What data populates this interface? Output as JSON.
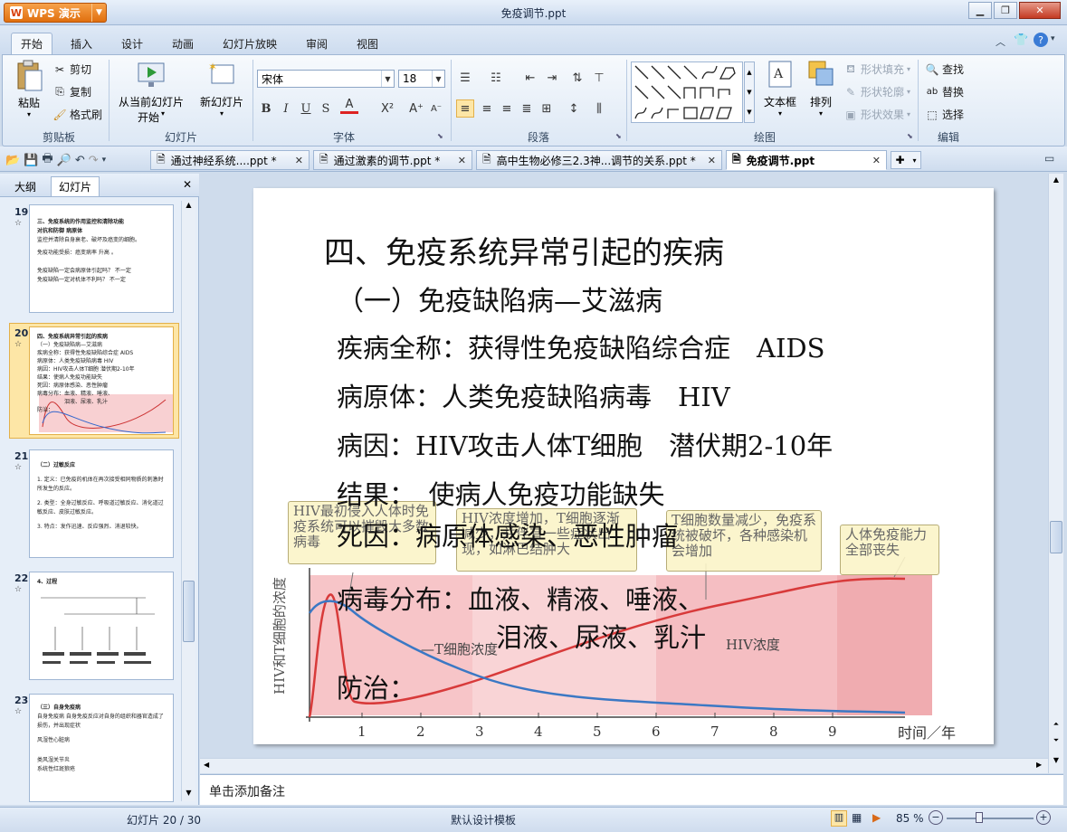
{
  "app": {
    "name": "WPS 演示",
    "window_title": "免疫调节.ppt"
  },
  "menu": {
    "tabs": [
      "开始",
      "插入",
      "设计",
      "动画",
      "幻灯片放映",
      "审阅",
      "视图"
    ],
    "active": "开始"
  },
  "ribbon": {
    "clipboard": {
      "paste": "粘贴",
      "cut": "剪切",
      "copy": "复制",
      "format_painter": "格式刷",
      "label": "剪贴板"
    },
    "slides": {
      "from_current": "从当前幻灯片",
      "start": "开始",
      "new_slide": "新幻灯片",
      "label": "幻灯片"
    },
    "font": {
      "name": "宋体",
      "size": "18",
      "bold": "B",
      "italic": "I",
      "underline": "U",
      "strike": "S",
      "label": "字体"
    },
    "paragraph": {
      "label": "段落"
    },
    "drawing": {
      "textbox": "文本框",
      "arrange": "排列",
      "shape_fill": "形状填充",
      "shape_outline": "形状轮廓",
      "shape_effect": "形状效果",
      "label": "绘图"
    },
    "editing": {
      "find": "查找",
      "replace": "替换",
      "select": "选择",
      "label": "编辑"
    }
  },
  "doc_tabs": [
    {
      "label": "通过神经系统....ppt *"
    },
    {
      "label": "通过激素的调节.ppt *"
    },
    {
      "label": "高中生物必修三2.3神...调节的关系.ppt *"
    },
    {
      "label": "免疫调节.ppt"
    }
  ],
  "left_panel": {
    "tabs": [
      "大纲",
      "幻灯片"
    ],
    "thumbs": [
      {
        "num": "19",
        "lines": [
          "三、免疫系统的作用监控和清除功能",
          "对抗和防御 病原体",
          "监控并清除自身衰老、破坏及癌变的细胞。",
          "免疫功能受损：癌变病率 升高 。",
          "免疫缺陷一定会病原体引起吗？ 不一定",
          "免疫缺陷一定对机体不利吗？ 不一定"
        ]
      },
      {
        "num": "20",
        "lines": [
          "四、免疫系统异常引起的疾病",
          "（一）免疫缺陷病—艾滋病",
          "疾病全称：获得性免疫缺陷综合症 AIDS",
          "病原体：人类免疫缺陷病毒 HIV",
          "病因：HIV攻击人体T细胞 潜伏期2-10年",
          "结果：使病人免疫功能缺失",
          "死因：病原体感染、恶性肿瘤",
          "病毒分布：血液、精液、唾液、",
          "泪液、尿液、乳汁",
          "防治："
        ]
      },
      {
        "num": "21",
        "lines": [
          "（二）过敏反应",
          "1. 定义：已免疫的机体在再次接受相同物质的刺激时所发生的反应。",
          "2. 类型：全身过敏反应、呼吸道过敏反应、消化道过敏反应、皮肤过敏反应。",
          "3. 特点：发作迅速、反应强烈、消退较快。"
        ]
      },
      {
        "num": "22",
        "lines": [
          "4、过程"
        ]
      },
      {
        "num": "23",
        "lines": [
          "（三）自身免疫病",
          "自身免疫病 自身免疫反应对自身的组织和器官造成了损伤，并出现症状",
          "风湿性心脏病",
          "类风湿关节炎",
          "系统性红斑狼疮"
        ]
      }
    ]
  },
  "slide": {
    "title": "四、免疫系统异常引起的疾病",
    "subtitle": "（一）免疫缺陷病—艾滋病",
    "lines": [
      "疾病全称：获得性免疫缺陷综合症　AIDS",
      "病原体：人类免疫缺陷病毒　HIV",
      "病因：HIV攻击人体T细胞　潜伏期2-10年",
      "结果：　使病人免疫功能缺失",
      "死因：病原体感染、恶性肿瘤",
      "病毒分布：血液、精液、唾液、",
      "泪液、尿液、乳汁",
      "防治："
    ],
    "chart": {
      "ylabel": "HIV和T细胞的浓度",
      "xlabel": "时间／年",
      "x_ticks": [
        "1",
        "2",
        "3",
        "4",
        "5",
        "6",
        "7",
        "8",
        "9"
      ],
      "t_label": "T细胞浓度",
      "hiv_label": "HIV浓度",
      "callouts": [
        "HIV最初侵入人体时免疫系统可以摧毁大多数病毒",
        "HIV浓度增加，T细胞逐渐减少，并伴有一些症状出现，如淋巴结肿大",
        "T细胞数量减少，免疫系统被破坏，各种感染机会增加",
        "人体免疫能力全部丧失"
      ]
    }
  },
  "notes_placeholder": "单击添加备注",
  "status": {
    "slide_pos": "幻灯片 20 / 30",
    "template": "默认设计模板",
    "zoom": "85 %"
  },
  "colors": {
    "wps_orange": "#e8801f",
    "hiv_curve": "#d83a3a",
    "t_curve": "#3b78c4",
    "chart_band": "#f5b5b8"
  }
}
